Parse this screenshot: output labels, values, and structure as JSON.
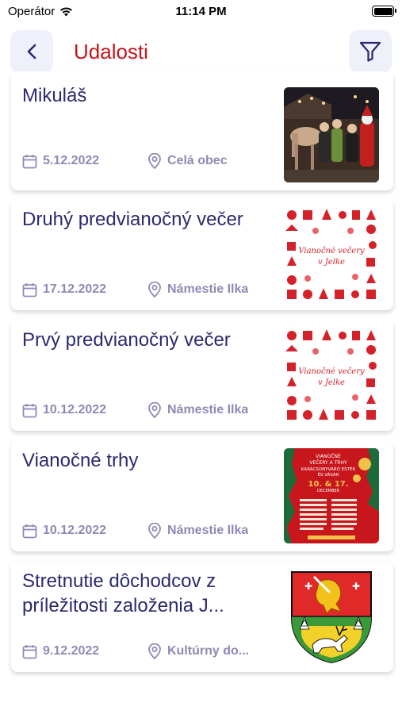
{
  "status_bar": {
    "carrier": "Operátor",
    "time": "11:14 PM"
  },
  "header": {
    "title": "Udalosti"
  },
  "events": [
    {
      "title": "Mikuláš",
      "date": "5.12.2022",
      "place": "Celá obec",
      "image": "santa-photo"
    },
    {
      "title": "Druhý predvianočný večer",
      "date": "17.12.2022",
      "place": "Námestie Ilka",
      "image": "christmas-evenings-poster"
    },
    {
      "title": "Prvý predvianočný večer",
      "date": "10.12.2022",
      "place": "Námestie Ilka",
      "image": "christmas-evenings-poster"
    },
    {
      "title": "Vianočné trhy",
      "date": "10.12.2022",
      "place": "Námestie Ilka",
      "image": "christmas-market-poster"
    },
    {
      "title": "Stretnutie dôchodcov z príležitosti založenia J...",
      "date": "9.12.2022",
      "place": "Kultúrny do...",
      "image": "village-coat-of-arms"
    }
  ],
  "posters": {
    "vianocne": {
      "line1": "Vianočné večery",
      "line2": "v Jelke"
    },
    "trhy": {
      "line1": "VIANOČNÉ",
      "line2": "VEČERY A TRHY",
      "line3": "KARÁCSONYVÁRÓ ESTÉK",
      "line4": "ÉS VÁSÁR",
      "dates": "10. & 17.",
      "month": "DECEMBER"
    }
  },
  "colors": {
    "accent": "#c8141c",
    "text": "#2b2a6e",
    "meta": "#8d8ab5",
    "button_bg": "#eef0fa"
  },
  "icons": {
    "back": "chevron-left-icon",
    "filter": "filter-icon",
    "date": "calendar-icon",
    "place": "location-pin-icon"
  }
}
